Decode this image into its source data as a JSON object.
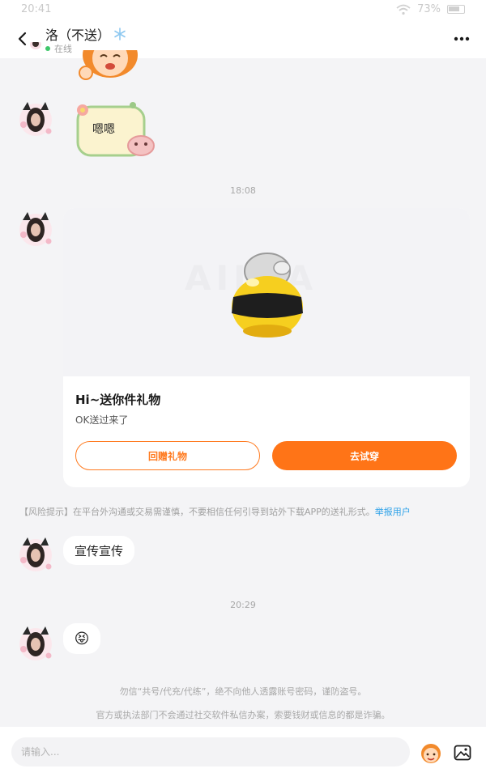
{
  "status_bar": {
    "time": "20:41",
    "battery": "73%"
  },
  "header": {
    "name": "洛（不送）",
    "badge_icon": "snowflake-icon",
    "status": "在线"
  },
  "messages": {
    "bubble_text": "嗯嗯",
    "time1": "18:08",
    "gift": {
      "title": "Hi~送你件礼物",
      "subtitle": "OK送过来了",
      "return_gift_label": "回赠礼物",
      "try_on_label": "去试穿",
      "watermark": "AILLA"
    },
    "risk_prefix": "【风险提示】在平台外沟通或交易需谨慎，不要相信任何引导到站外下载APP的送礼形式。",
    "risk_link": "举报用户",
    "text1": "宣传宣传",
    "time2": "20:29",
    "emoji": "😝"
  },
  "notices": {
    "line1": "勿信“共号/代充/代练”，绝不向他人透露账号密码，谨防盗号。",
    "line2": "官方或执法部门不会通过社交软件私信办案，索要钱财或信息的都是诈骗。"
  },
  "input": {
    "placeholder": "请输入..."
  },
  "colors": {
    "accent": "#ff7417",
    "link": "#2aa0e8",
    "online": "#3ec76a"
  }
}
